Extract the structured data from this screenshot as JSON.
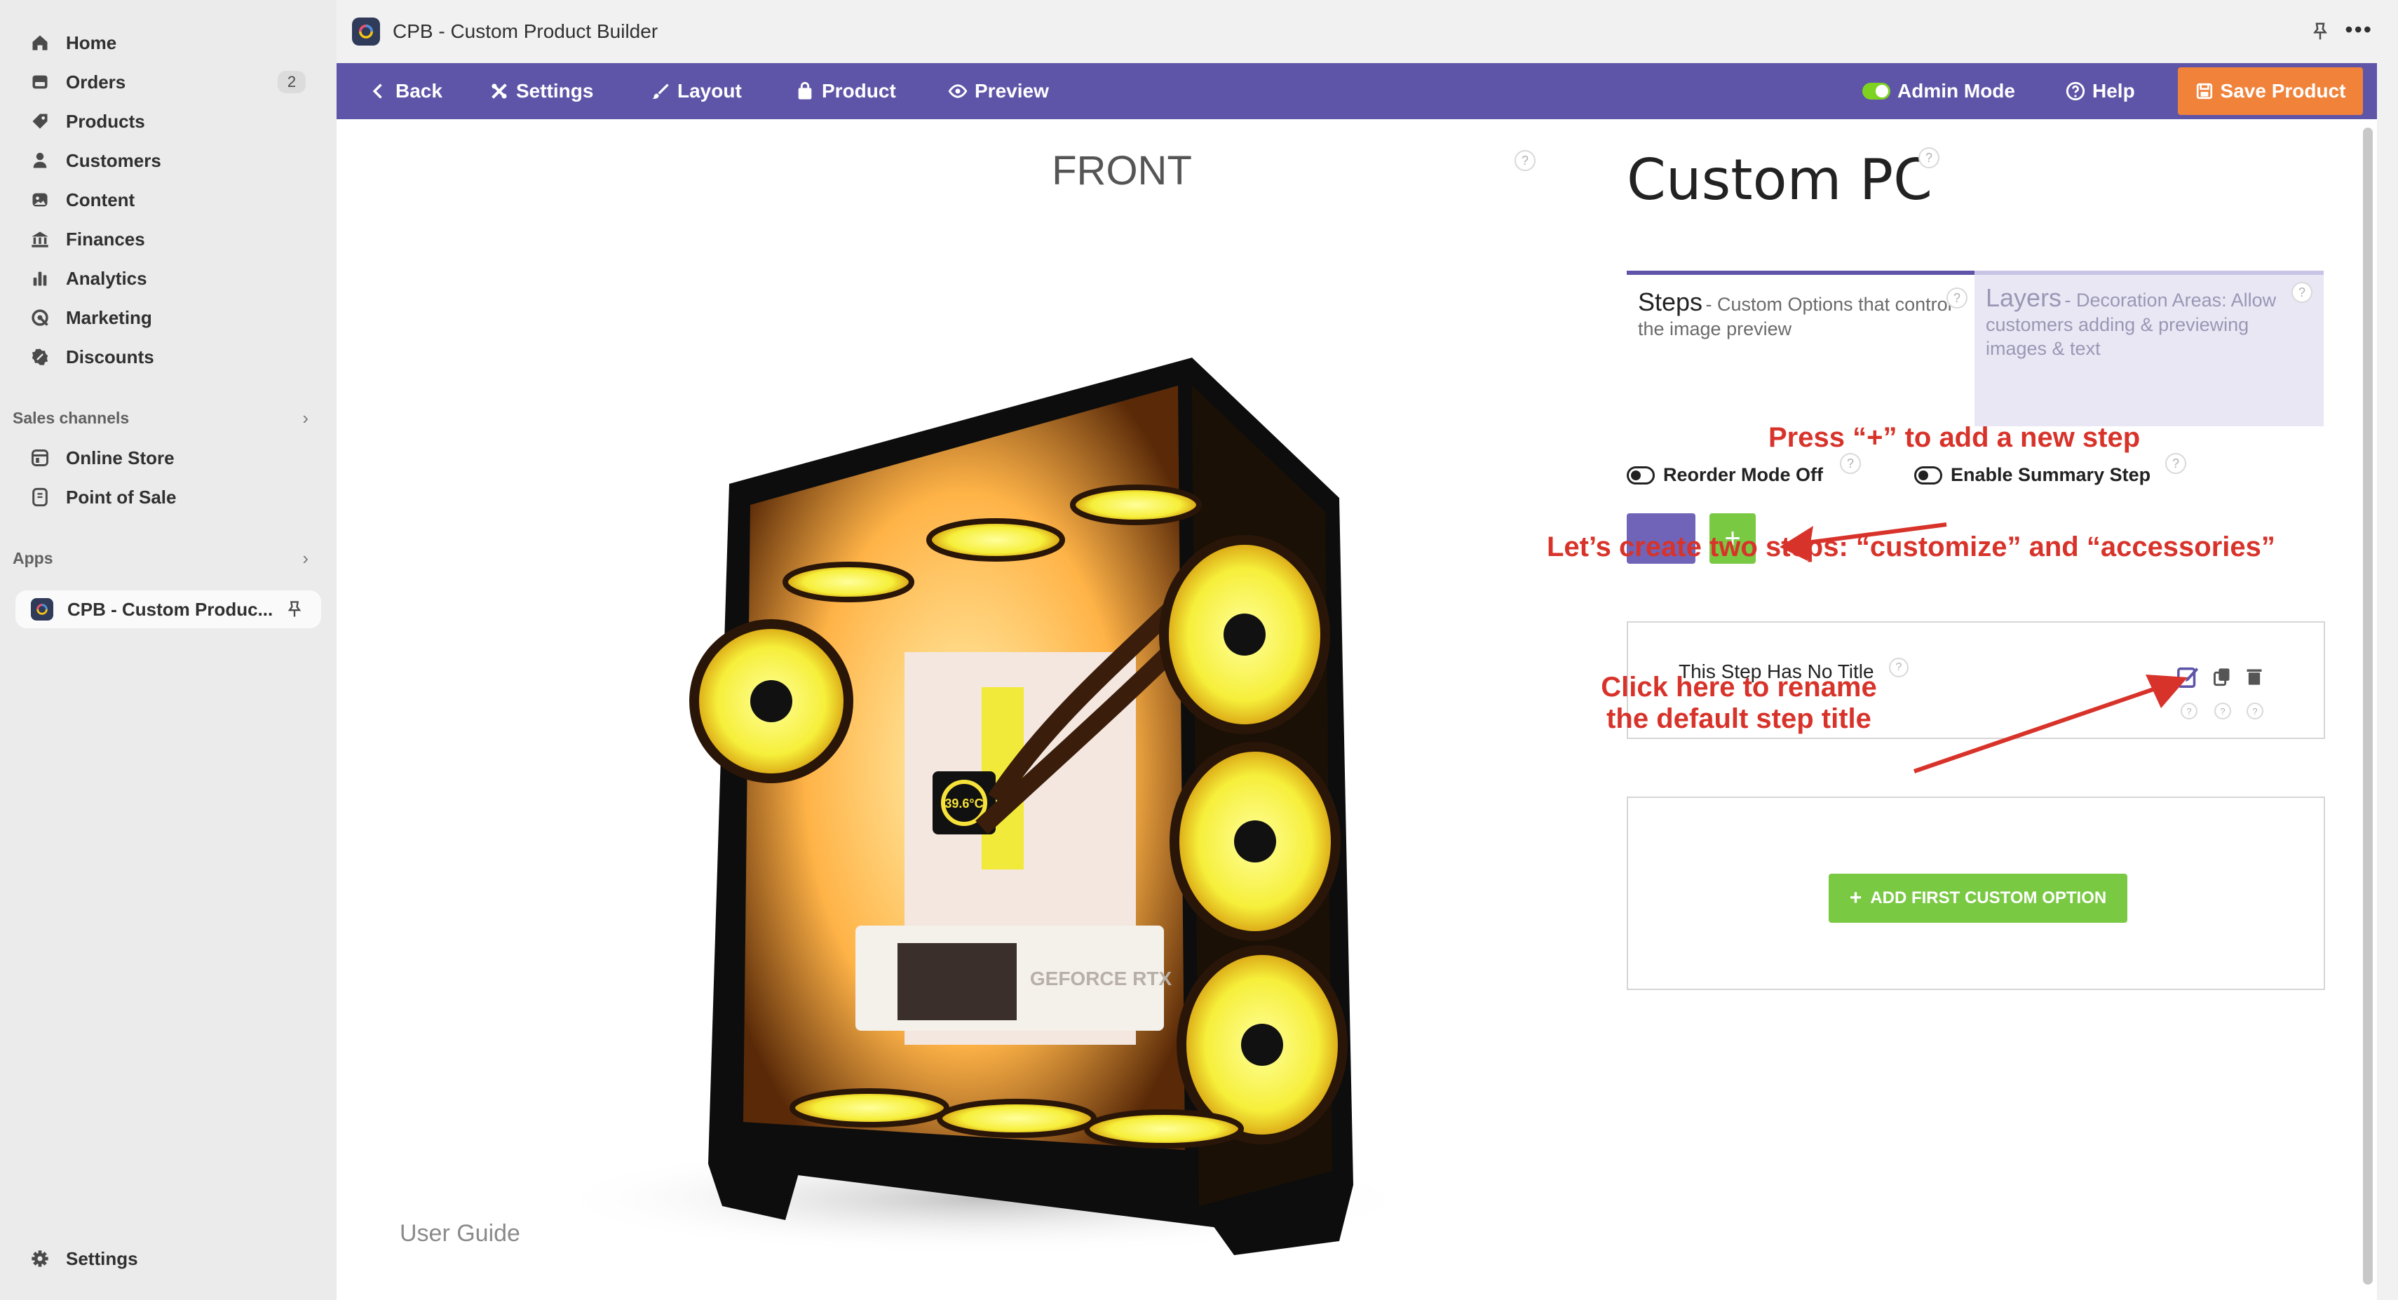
{
  "sidebar": {
    "items": [
      {
        "label": "Home",
        "icon": "home-icon"
      },
      {
        "label": "Orders",
        "icon": "orders-icon",
        "badge": "2"
      },
      {
        "label": "Products",
        "icon": "tag-icon"
      },
      {
        "label": "Customers",
        "icon": "person-icon"
      },
      {
        "label": "Content",
        "icon": "content-icon"
      },
      {
        "label": "Finances",
        "icon": "bank-icon"
      },
      {
        "label": "Analytics",
        "icon": "bar-chart-icon"
      },
      {
        "label": "Marketing",
        "icon": "target-icon"
      },
      {
        "label": "Discounts",
        "icon": "discount-icon"
      }
    ],
    "sales_channels_heading": "Sales channels",
    "sales_channels": [
      {
        "label": "Online Store",
        "icon": "store-icon"
      },
      {
        "label": "Point of Sale",
        "icon": "pos-icon"
      }
    ],
    "apps_heading": "Apps",
    "active_app": "CPB - Custom Produc...",
    "settings_label": "Settings"
  },
  "titlebar": {
    "title": "CPB - Custom Product Builder"
  },
  "toolbar": {
    "back": "Back",
    "settings": "Settings",
    "layout": "Layout",
    "product": "Product",
    "preview": "Preview",
    "admin_mode": "Admin Mode",
    "help": "Help",
    "save": "Save Product",
    "colors": {
      "bar": "#5e55a8",
      "save": "#f0823a",
      "toggle_on": "#7ed321"
    }
  },
  "canvas": {
    "view_label": "FRONT",
    "user_guide": "User Guide",
    "help_mark": "?"
  },
  "product": {
    "title": "Custom PC"
  },
  "tabs": {
    "steps_name": "Steps",
    "steps_desc": "- Custom Options that control the image preview",
    "layers_name": "Layers",
    "layers_desc": "- Decoration Areas: Allow customers adding & previewing images & text"
  },
  "controls": {
    "reorder_label": "Reorder Mode Off",
    "summary_label": "Enable Summary Step",
    "add_step": "+"
  },
  "step": {
    "title": "This Step Has No Title",
    "add_option": "ADD FIRST CUSTOM OPTION"
  },
  "annotations": {
    "press_plus": "Press “+” to add a new step",
    "create_two": "Let’s create two steps: “customize” and “accessories”",
    "rename_line1": "Click here to rename",
    "rename_line2": "the default step title",
    "color": "#d8332a"
  },
  "illustration": {
    "gpu_text": "GEFORCE RTX",
    "pump_text": "39.6°C"
  }
}
